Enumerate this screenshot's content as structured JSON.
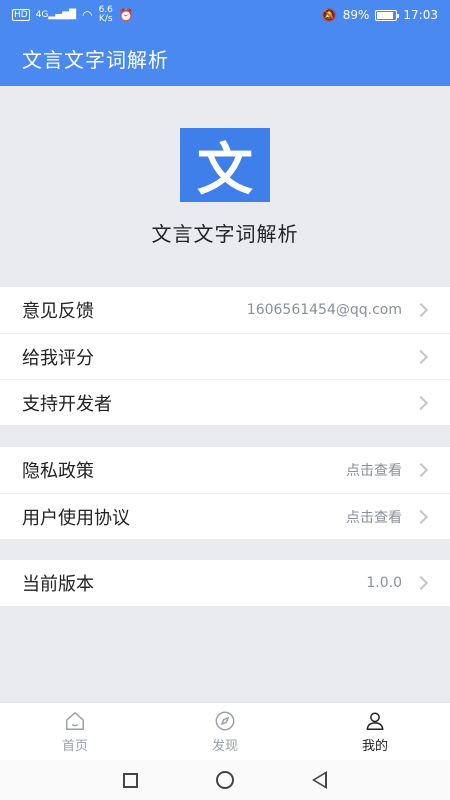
{
  "status_bar": {
    "network": "HD",
    "signal": "4G",
    "speed_value": "6.6",
    "speed_unit": "K/s",
    "battery": "89%",
    "battery_level": 0.89,
    "time": "17:03"
  },
  "app_bar": {
    "title": "文言文字词解析"
  },
  "hero": {
    "logo_char": "文",
    "app_name": "文言文字词解析"
  },
  "groups": [
    [
      {
        "label": "意见反馈",
        "value": "1606561454@qq.com"
      },
      {
        "label": "给我评分",
        "value": ""
      },
      {
        "label": "支持开发者",
        "value": ""
      }
    ],
    [
      {
        "label": "隐私政策",
        "value": "点击查看"
      },
      {
        "label": "用户使用协议",
        "value": "点击查看"
      }
    ],
    [
      {
        "label": "当前版本",
        "value": "1.0.0"
      }
    ]
  ],
  "tabs": [
    {
      "label": "首页",
      "icon": "home-icon",
      "active": false
    },
    {
      "label": "发现",
      "icon": "compass-icon",
      "active": false
    },
    {
      "label": "我的",
      "icon": "user-icon",
      "active": true
    }
  ],
  "colors": {
    "primary": "#4a8af0",
    "logo_bg": "#3e7fea",
    "background": "#e9ebef"
  }
}
